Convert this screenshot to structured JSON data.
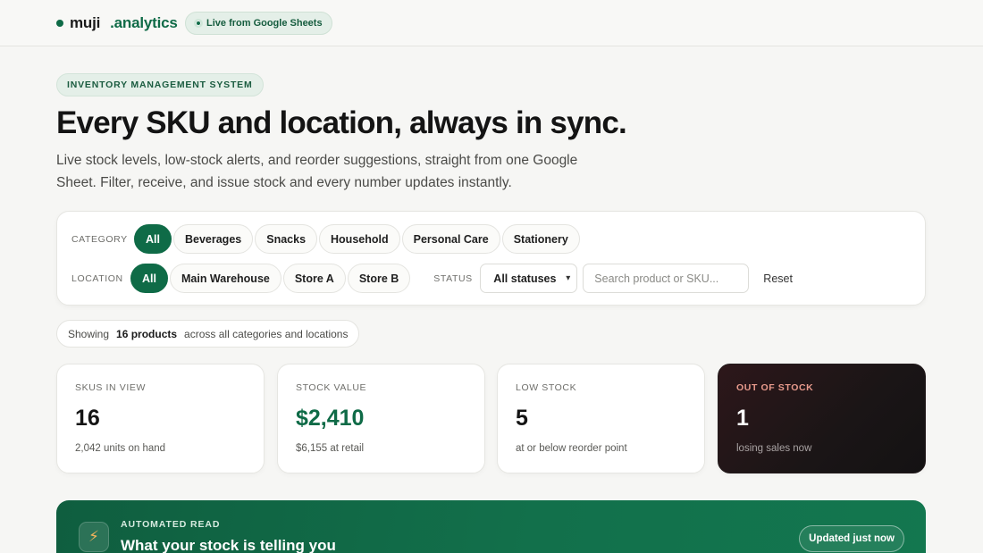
{
  "header": {
    "brand_name": "muji",
    "brand_accent": ".analytics",
    "live_label": "Live from Google Sheets"
  },
  "hero": {
    "eyebrow": "INVENTORY MANAGEMENT SYSTEM",
    "title": "Every SKU and location, always in sync.",
    "subtitle": "Live stock levels, low-stock alerts, and reorder suggestions, straight from one Google Sheet. Filter, receive, and issue stock and every number updates instantly."
  },
  "filters": {
    "category_label": "CATEGORY",
    "categories": [
      "All",
      "Beverages",
      "Snacks",
      "Household",
      "Personal Care",
      "Stationery"
    ],
    "location_label": "LOCATION",
    "locations": [
      "All",
      "Main Warehouse",
      "Store A",
      "Store B"
    ],
    "status_label": "STATUS",
    "status_value": "All statuses",
    "search_placeholder": "Search product or SKU...",
    "reset_label": "Reset"
  },
  "showing": {
    "prefix": "Showing",
    "count": "16 products",
    "suffix": "across all categories and locations"
  },
  "kpis": [
    {
      "label": "SKUS IN VIEW",
      "value": "16",
      "sub": "2,042 units on hand"
    },
    {
      "label": "STOCK VALUE",
      "value": "$2,410",
      "sub": "$6,155 at retail"
    },
    {
      "label": "LOW STOCK",
      "value": "5",
      "sub": "at or below reorder point"
    },
    {
      "label": "OUT OF STOCK",
      "value": "1",
      "sub": "losing sales now"
    }
  ],
  "automated_read": {
    "eyebrow": "AUTOMATED READ",
    "title": "What your stock is telling you",
    "updated": "Updated just now",
    "icon": "lightning-icon"
  },
  "colors": {
    "brand_green": "#0f6b47",
    "dark_card": "#1a1516",
    "alert_label": "#e89a8c"
  }
}
